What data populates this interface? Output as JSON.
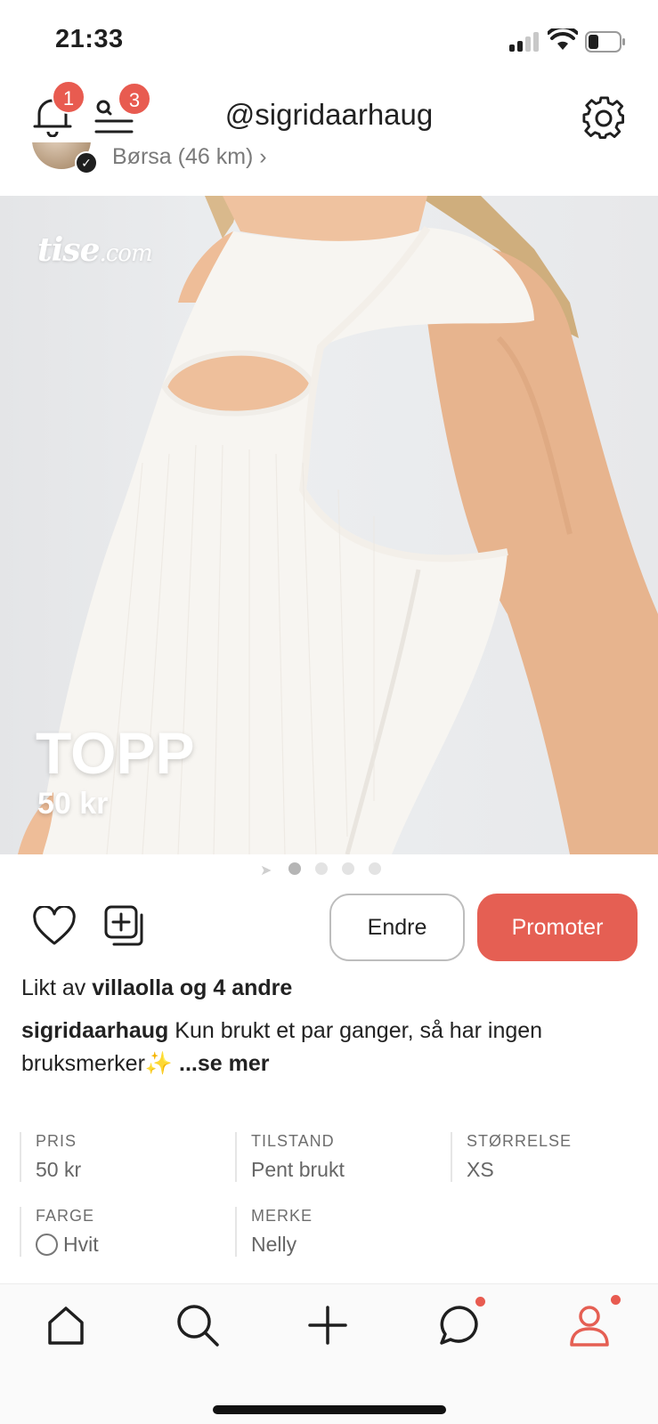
{
  "status_bar": {
    "time": "21:33"
  },
  "header": {
    "username": "@sigridaarhaug",
    "notification_count": "1",
    "menu_count": "3"
  },
  "profile": {
    "location": "Børsa (46 km) ›"
  },
  "product_image": {
    "watermark_main": "tise",
    "watermark_suffix": ".com",
    "title": "TOPP",
    "price": "50 kr",
    "page_count": 4,
    "current_page": 1
  },
  "actions": {
    "edit_label": "Endre",
    "promote_label": "Promoter"
  },
  "likes": {
    "prefix": "Likt av ",
    "user": "villaolla",
    "suffix": " og 4 andre"
  },
  "description": {
    "author": "sigridaarhaug",
    "text": " Kun brukt et par ganger, så har ingen bruksmerker✨ ",
    "more": "...se mer"
  },
  "details": [
    {
      "label": "PRIS",
      "value": "50 kr"
    },
    {
      "label": "TILSTAND",
      "value": "Pent brukt"
    },
    {
      "label": "STØRRELSE",
      "value": "XS"
    },
    {
      "label": "FARGE",
      "value": "Hvit"
    },
    {
      "label": "MERKE",
      "value": "Nelly"
    }
  ],
  "bottom_nav": {
    "items": [
      "home-icon",
      "search-icon",
      "plus-icon",
      "chat-icon",
      "profile-icon"
    ],
    "active": "profile-icon"
  },
  "colors": {
    "accent": "#e55f53",
    "badge": "#e85b50",
    "text": "#1f1f1f",
    "muted": "#6e6e6e"
  }
}
